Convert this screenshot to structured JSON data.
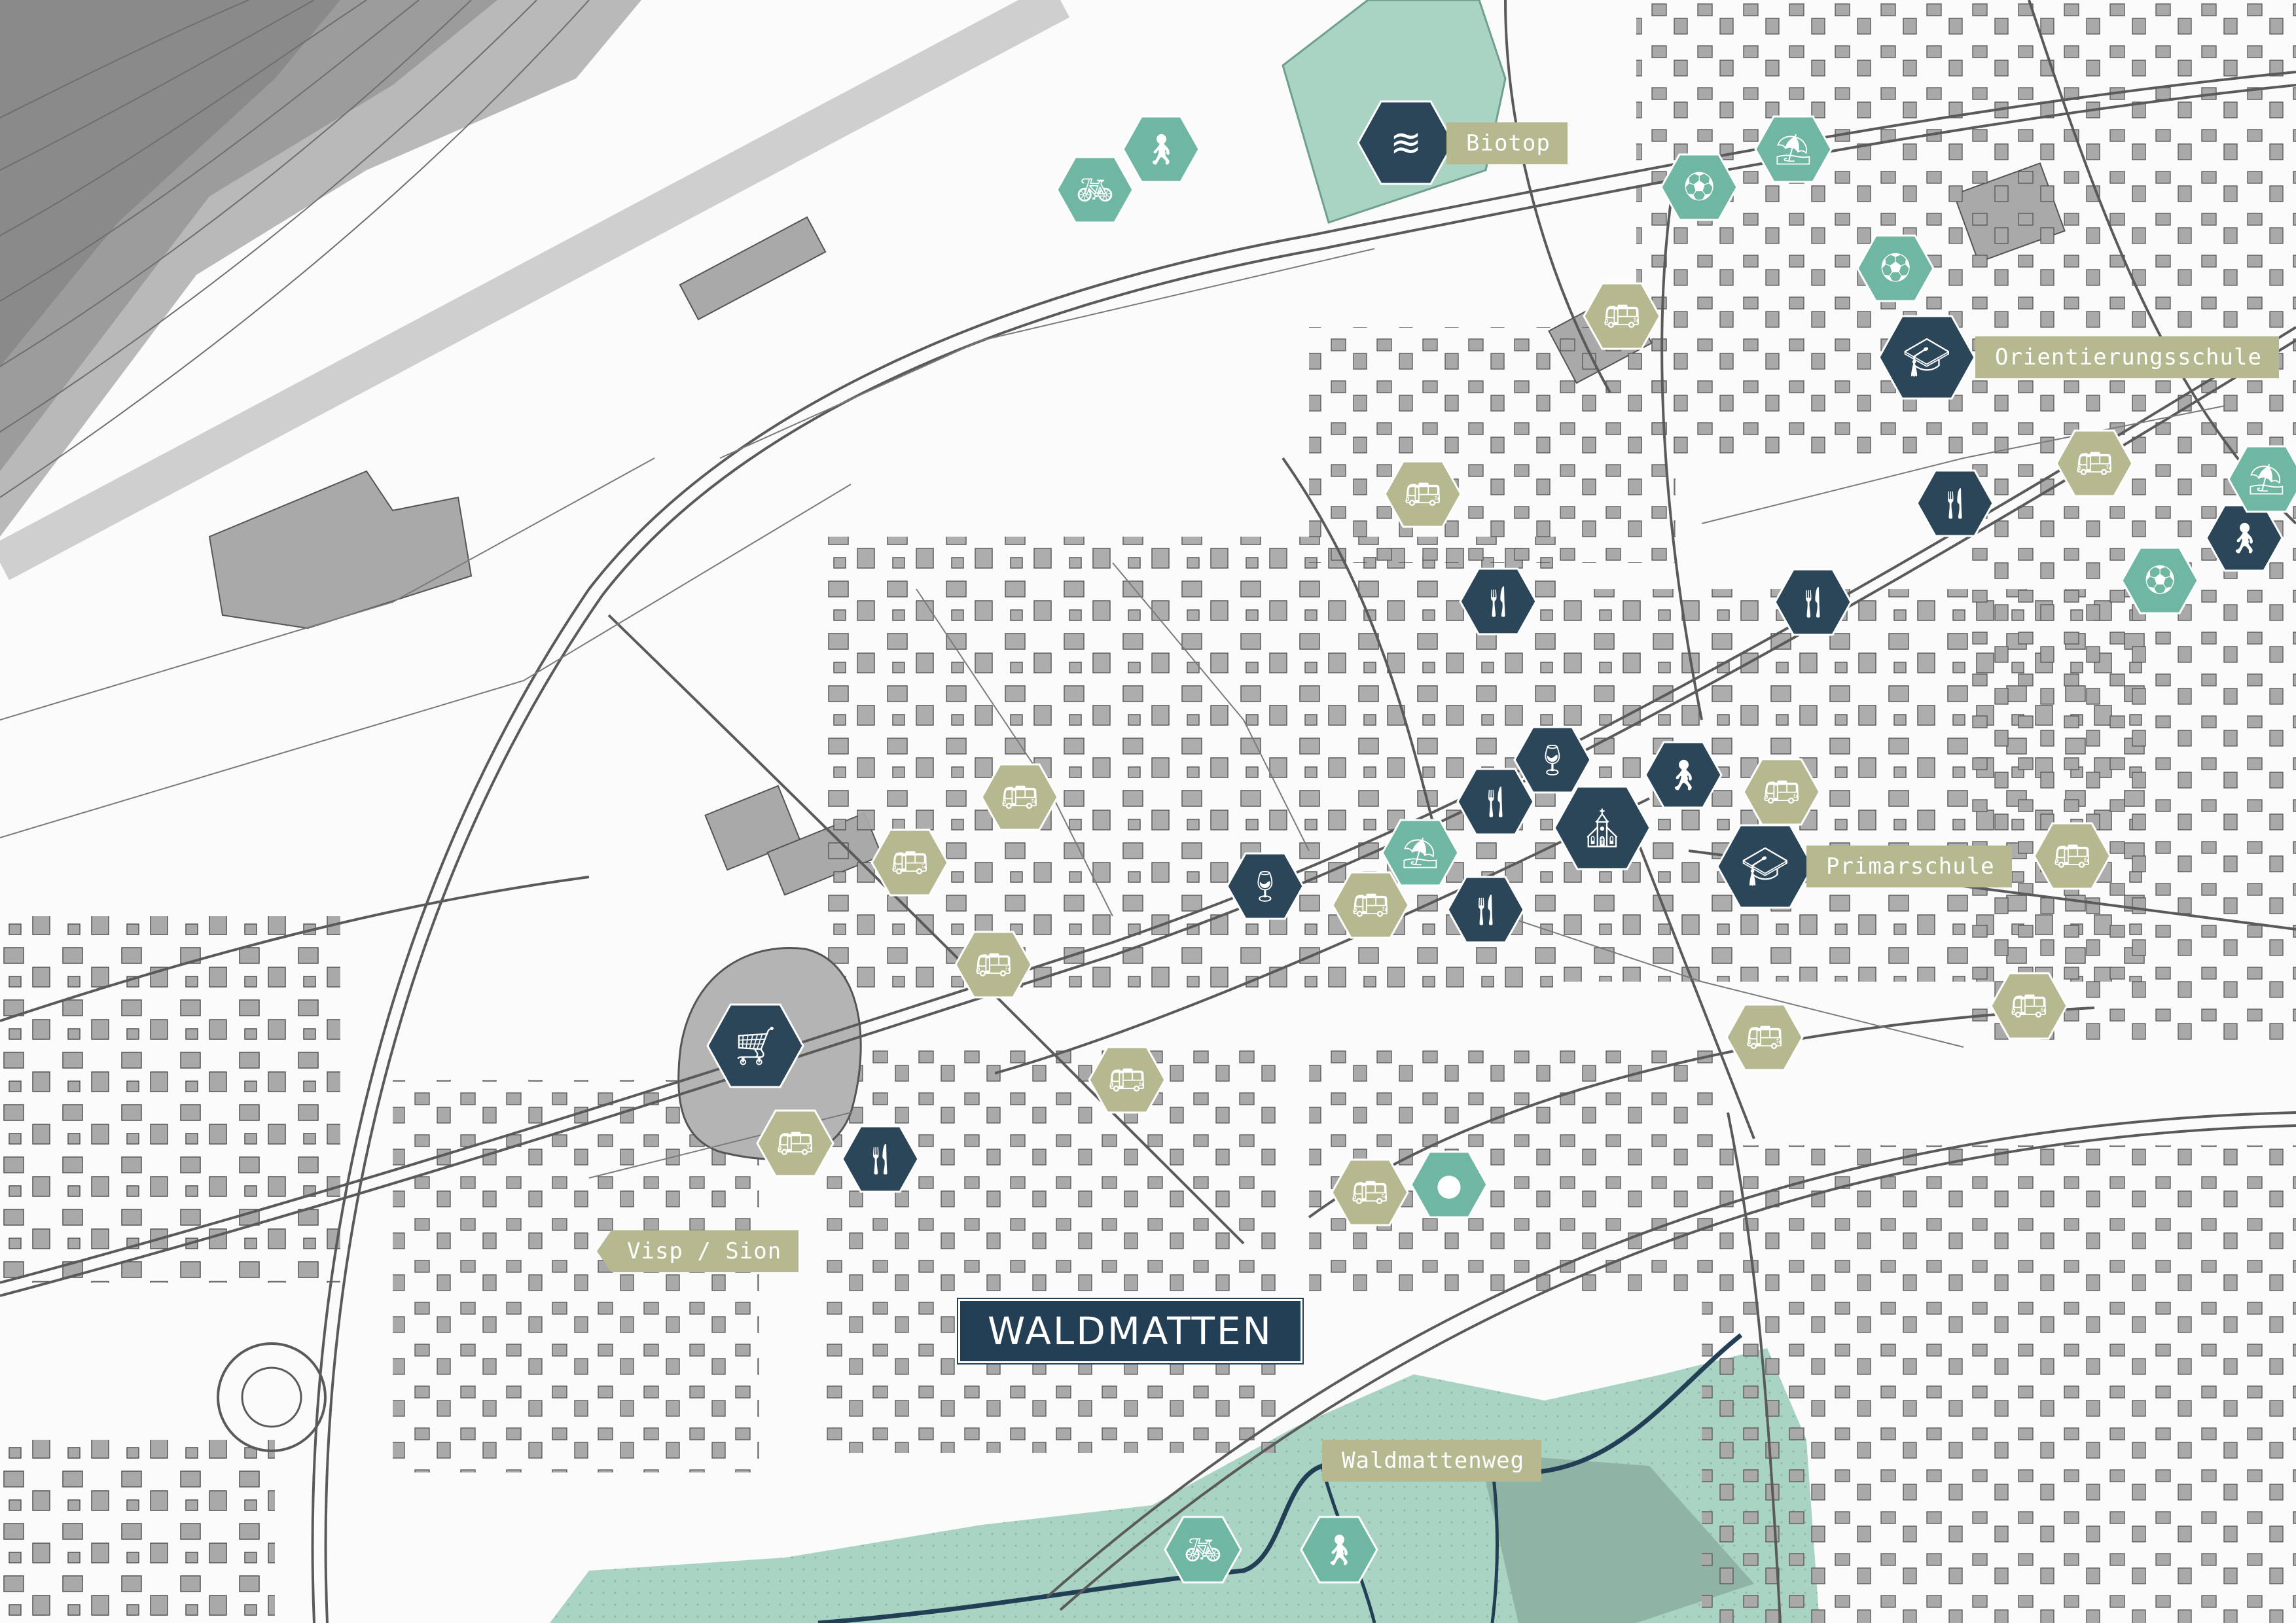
{
  "map": {
    "title": "WALDMATTEN",
    "labels": {
      "biotop": "Biotop",
      "orientierungsschule": "Orientierungsschule",
      "primarschule": "Primarschule",
      "visp_sion": "Visp / Sion",
      "waldmattenweg": "Waldmattenweg"
    },
    "colors": {
      "dark_marker": "#2b4559",
      "green_marker": "#6fb7a2",
      "olive_marker": "#b6b98f",
      "green_area": "#a9d3c3",
      "buildings": "#a9a9a9",
      "roads": "#5a5a5a",
      "river": "#233f55"
    },
    "icons": {
      "cart": "shopping-cart-icon",
      "fork_knife": "restaurant-icon",
      "bus": "bus-icon",
      "glass": "wine-glass-icon",
      "church": "church-icon",
      "graduation": "graduation-cap-icon",
      "bike": "bicycle-icon",
      "hiker": "hiking-icon",
      "football": "football-icon",
      "playground": "playground-icon",
      "tennis": "tennis-icon",
      "person": "person-icon",
      "water": "water-icon"
    }
  }
}
